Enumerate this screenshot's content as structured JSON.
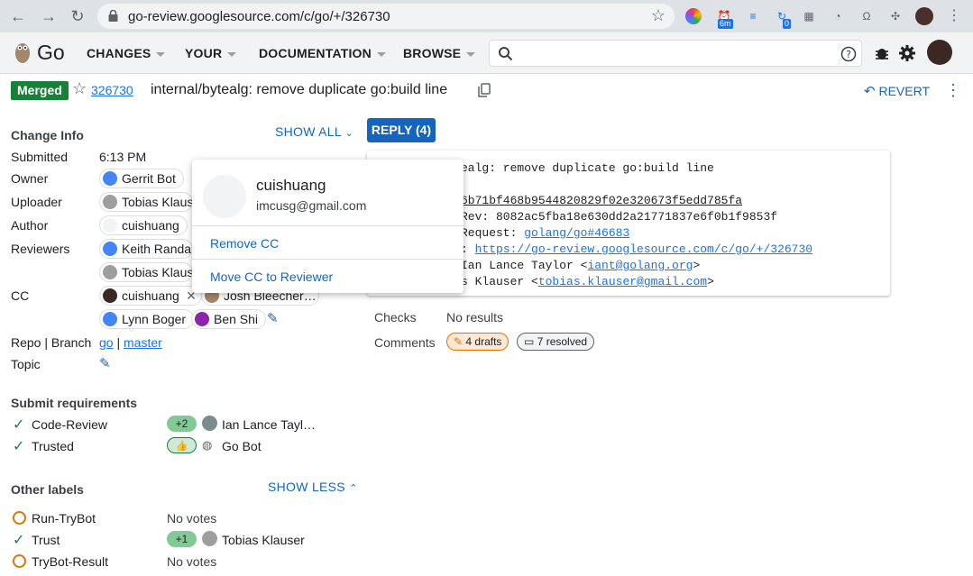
{
  "browser": {
    "url": "go-review.googlesource.com/c/go/+/326730",
    "ext_badge_1": "6m",
    "ext_badge_2": "0"
  },
  "header": {
    "brand": "Go",
    "menus": [
      "CHANGES",
      "YOUR",
      "DOCUMENTATION",
      "BROWSE"
    ],
    "search_placeholder": ""
  },
  "change": {
    "status": "Merged",
    "number": "326730",
    "subject": "internal/bytealg: remove duplicate go:build line",
    "revert_label": "REVERT"
  },
  "info": {
    "section_title": "Change Info",
    "show_all": "SHOW ALL",
    "reply": "REPLY (4)",
    "submitted_label": "Submitted",
    "submitted_value": "6:13 PM",
    "owner_label": "Owner",
    "owner": "Gerrit Bot",
    "uploader_label": "Uploader",
    "uploader": "Tobias Klaus",
    "author_label": "Author",
    "author": "cuishuang",
    "reviewers_label": "Reviewers",
    "reviewers": [
      "Keith Randal",
      "Tobias Klaus"
    ],
    "cc_label": "CC",
    "cc": [
      "cuishuang",
      "Josh Bleecher…",
      "Lynn Boger",
      "Ben Shi"
    ],
    "repo_label": "Repo | Branch",
    "repo": "go",
    "sep": "|",
    "branch": "master",
    "topic_label": "Topic"
  },
  "commit_message": {
    "lines": [
      "ealg: remove duplicate go:build line",
      "",
      "",
      "Rev: 8082ac5fba18e630dd2a21771837e6f0b1f9853f",
      "Request: ",
      "",
      "Ian Lance Taylor <",
      "s Klauser <"
    ],
    "hash_link": "6b71bf468b9544820829f02e320673f5edd785fa",
    "pr_link": "golang/go#46683",
    "review_link": "https://go-review.googlesource.com/c/go/+/326730",
    "iant_email": "iant@golang.org",
    "iant_close": ">",
    "tobias_email": "tobias.klauser@gmail.com",
    "tobias_close": ">"
  },
  "checks": {
    "checks_label": "Checks",
    "checks_value": "No results",
    "comments_label": "Comments",
    "drafts": "4 drafts",
    "resolved": "7 resolved"
  },
  "submit_requirements": {
    "title": "Submit requirements",
    "items": [
      {
        "name": "Code-Review",
        "vote": "+2",
        "who": "Ian Lance Tayl…"
      },
      {
        "name": "Trusted",
        "vote": "👍",
        "who": "Go Bot"
      }
    ]
  },
  "other_labels": {
    "title": "Other labels",
    "show_less": "SHOW LESS",
    "items": [
      {
        "name": "Run-TryBot",
        "value": "No votes"
      },
      {
        "name": "Trust",
        "vote": "+1",
        "who": "Tobias Klauser"
      },
      {
        "name": "TryBot-Result",
        "value": "No votes"
      }
    ]
  },
  "popup": {
    "name": "cuishuang",
    "email": "imcusg@gmail.com",
    "action_1": "Remove CC",
    "action_2": "Move CC to Reviewer"
  },
  "colors": {
    "accent": "#1565c0",
    "merged": "#188038",
    "vote_green": "#81c995",
    "draft_orange": "#e37400"
  }
}
